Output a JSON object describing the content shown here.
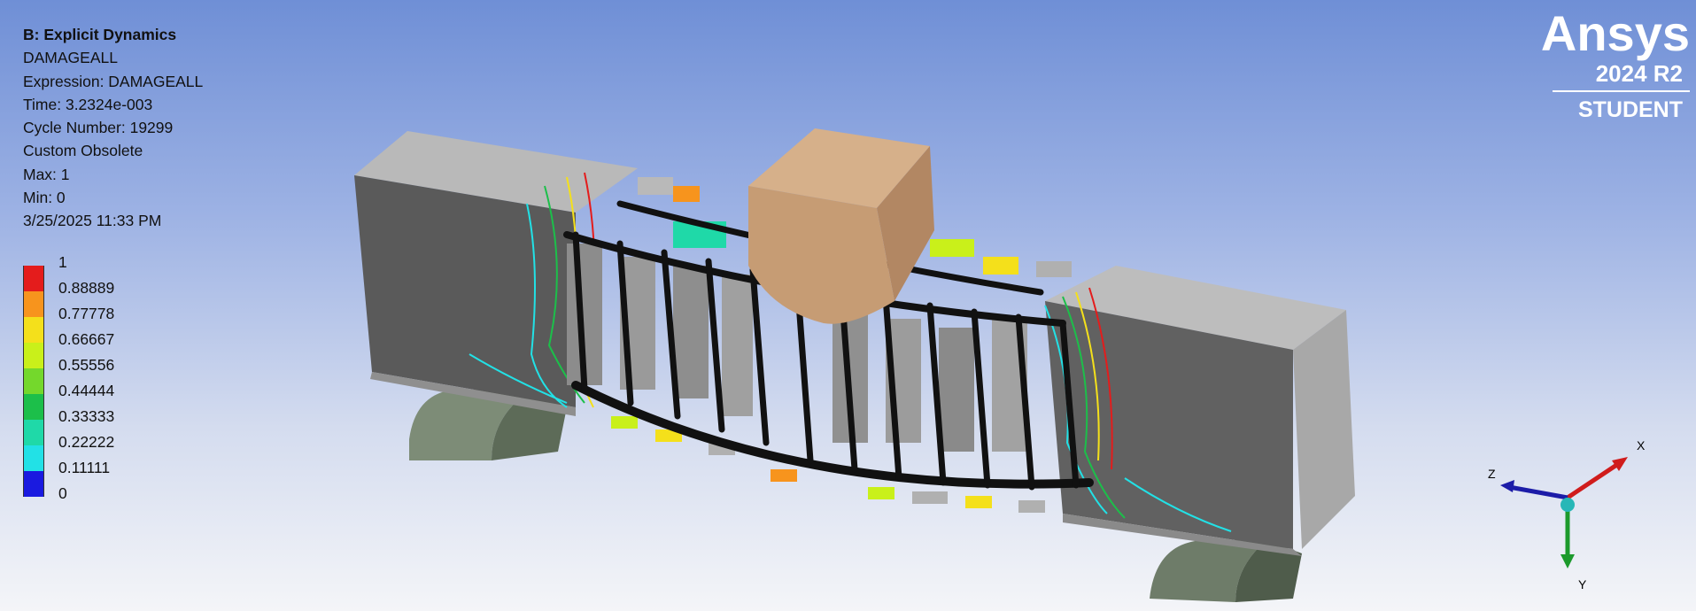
{
  "info": {
    "title": "B: Explicit Dynamics",
    "result": "DAMAGEALL",
    "expression": "Expression: DAMAGEALL",
    "time": "Time: 3.2324e-003",
    "cycle": "Cycle Number: 19299",
    "scheme": "Custom Obsolete",
    "max": "Max: 1",
    "min": "Min: 0",
    "timestamp": "3/25/2025 11:33 PM"
  },
  "legend": [
    {
      "label": "1",
      "color": "#e41c1c"
    },
    {
      "label": "0.88889",
      "color": "#f7941d"
    },
    {
      "label": "0.77778",
      "color": "#f4e01b"
    },
    {
      "label": "0.66667",
      "color": "#c9f01a"
    },
    {
      "label": "0.55556",
      "color": "#74d82c"
    },
    {
      "label": "0.44444",
      "color": "#1cbf4a"
    },
    {
      "label": "0.33333",
      "color": "#1fd9a8"
    },
    {
      "label": "0.22222",
      "color": "#22e1e6"
    },
    {
      "label": "0.11111",
      "color": "#1aa3ea"
    },
    {
      "label": "0",
      "color": "#1a1ae0"
    }
  ],
  "legend_extra": {
    "label": "",
    "color": ""
  },
  "logo": {
    "brand": "Ansys",
    "version": "2024 R2",
    "edition": "STUDENT"
  },
  "triad": {
    "x_label": "X",
    "y_label": "Y",
    "z_label": "Z",
    "x_color": "#d01c1c",
    "y_color": "#1c9a2c",
    "z_color": "#1c1ca8"
  },
  "model": {
    "beam_color": "#9b9b9b",
    "support_color": "#6f7f6a",
    "impactor_color": "#c79d76",
    "rebar_color": "#111111"
  }
}
